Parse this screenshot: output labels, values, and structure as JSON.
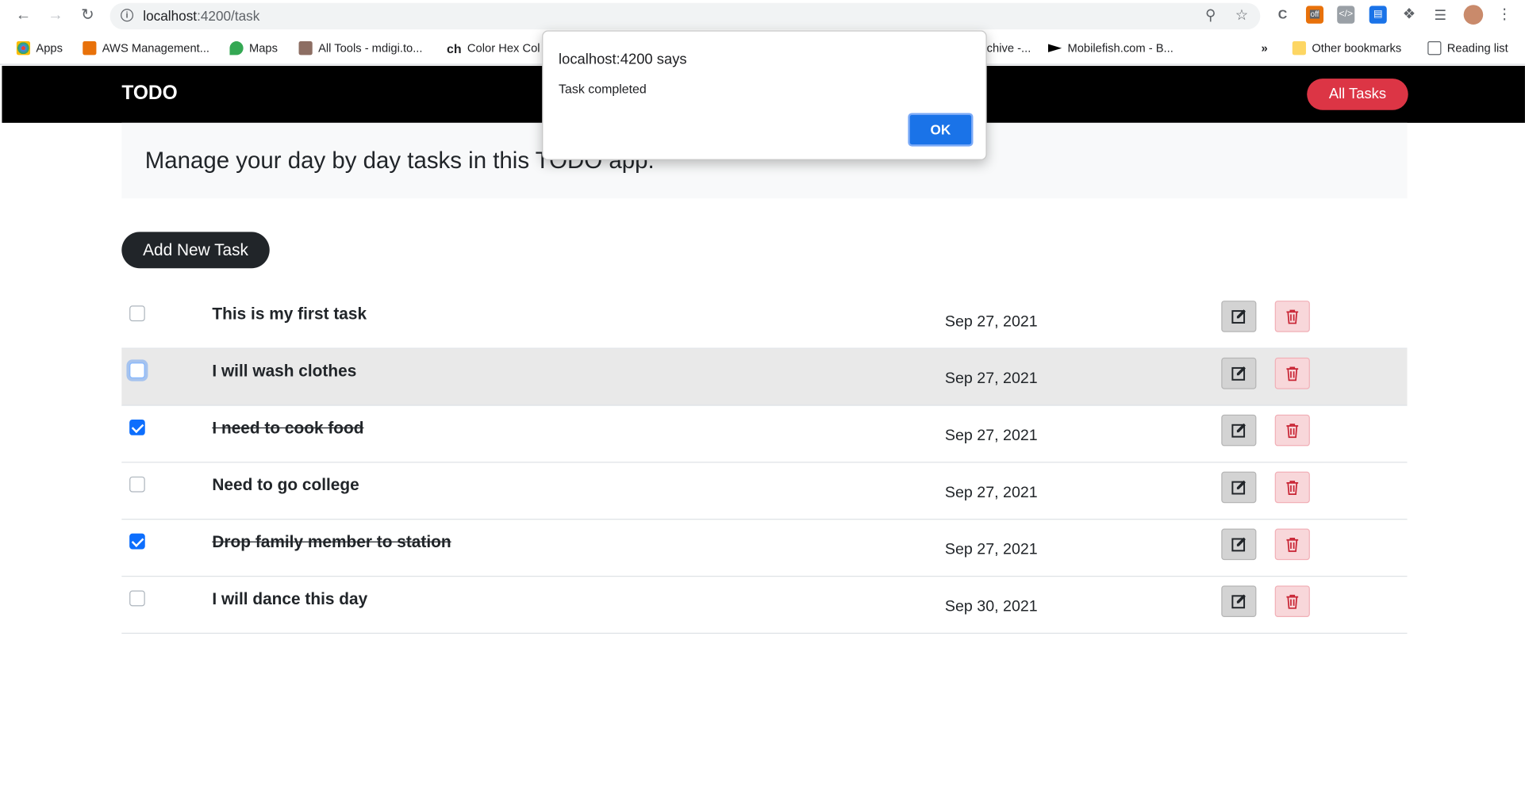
{
  "browser": {
    "url_host": "localhost",
    "url_rest": ":4200/task",
    "bookmarks": [
      {
        "label": "Apps"
      },
      {
        "label": "AWS Management..."
      },
      {
        "label": "Maps"
      },
      {
        "label": "All Tools - mdigi.to..."
      },
      {
        "label": "Color Hex Col"
      },
      {
        "label": "chive -..."
      },
      {
        "label": "Mobilefish.com - B..."
      },
      {
        "label": "Other bookmarks"
      },
      {
        "label": "Reading list"
      }
    ],
    "overflow_label": "»",
    "ext_off_label": "off"
  },
  "navbar": {
    "brand": "TODO",
    "all_tasks_label": "All Tasks",
    "all_tasks_color": "#dc3545"
  },
  "jumbotron": {
    "text": "Manage your day by day tasks in this TODO app."
  },
  "add_button_label": "Add New Task",
  "tasks": [
    {
      "title": "This is my first task",
      "date": "Sep 27, 2021",
      "done": false
    },
    {
      "title": "I will wash clothes",
      "date": "Sep 27, 2021",
      "done": false
    },
    {
      "title": "I need to cook food",
      "date": "Sep 27, 2021",
      "done": true
    },
    {
      "title": "Need to go college",
      "date": "Sep 27, 2021",
      "done": false
    },
    {
      "title": "Drop family member to station",
      "date": "Sep 27, 2021",
      "done": true
    },
    {
      "title": "I will dance this day",
      "date": "Sep 30, 2021",
      "done": false
    }
  ],
  "dialog": {
    "title": "localhost:4200 says",
    "message": "Task completed",
    "ok_label": "OK"
  }
}
